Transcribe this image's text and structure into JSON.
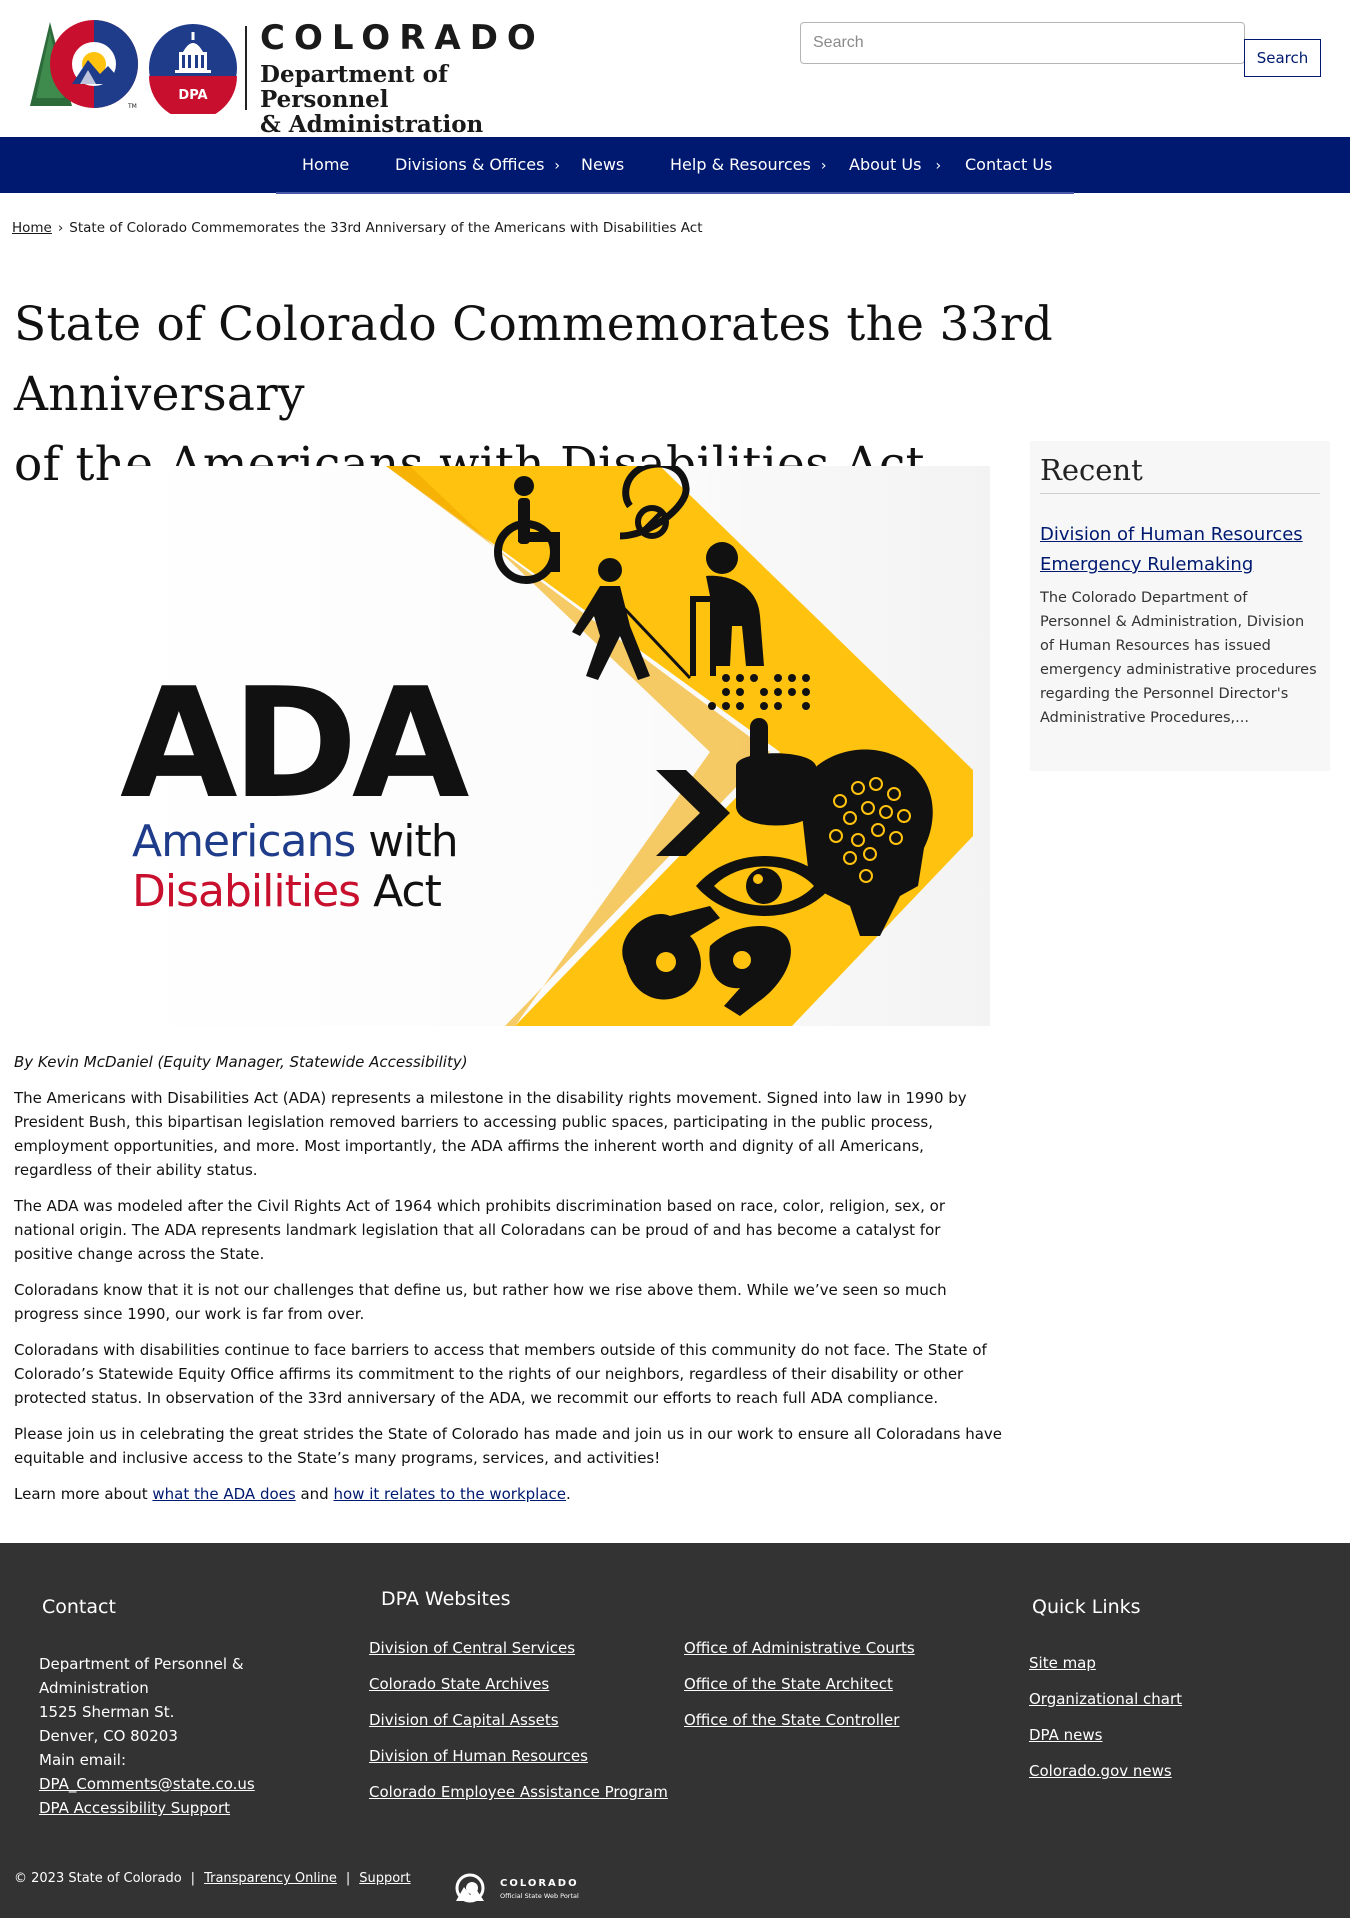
{
  "header": {
    "logo_state": "COLORADO",
    "logo_dept_line1": "Department of Personnel",
    "logo_dept_line2": "& Administration",
    "logo_badge": "DPA",
    "search_placeholder": "Search",
    "search_button": "Search"
  },
  "nav": {
    "items": [
      {
        "label": "Home",
        "has_submenu": false
      },
      {
        "label": "Divisions & Offices",
        "has_submenu": true
      },
      {
        "label": "News",
        "has_submenu": false
      },
      {
        "label": "Help & Resources",
        "has_submenu": true
      },
      {
        "label": "About Us",
        "has_submenu": true
      },
      {
        "label": "Contact Us",
        "has_submenu": false
      }
    ],
    "chevron": "›"
  },
  "breadcrumb": {
    "home": "Home",
    "separator": "›",
    "current": "State of Colorado Commemorates the 33rd Anniversary of the Americans with Disabilities Act"
  },
  "page_title_line1": "State of Colorado Commemorates the 33rd Anniversary",
  "page_title_line2": "of the Americans with Disabilities Act",
  "hero": {
    "ada": "ADA",
    "line1_a": "Americans",
    "line1_b": " with",
    "line2_a": "Disabilities",
    "line2_b": " Act"
  },
  "article": {
    "byline": "By Kevin McDaniel (Equity Manager, Statewide Accessibility)",
    "p1": "The Americans with Disabilities Act (ADA) represents a milestone in the disability rights movement. Signed into law in 1990 by President Bush, this bipartisan legislation removed barriers to accessing public spaces, participating in the public process, employment opportunities, and more. Most importantly, the ADA affirms the inherent worth and dignity of all Americans, regardless of their ability status.",
    "p2": "The ADA was modeled after the Civil Rights Act of 1964 which prohibits discrimination based on race, color, religion, sex, or national origin. The ADA represents landmark legislation that all Coloradans can be proud of and has become a catalyst for positive change across the State.",
    "p3": "Coloradans know that it is not our challenges that define us, but rather how we rise above them. While we’ve seen so much progress since 1990, our work is far from over.",
    "p4": "Coloradans with disabilities continue to face barriers to access that members outside of this community do not face. The State of Colorado’s Statewide Equity Office affirms its commitment to the rights of our neighbors, regardless of their disability or other protected status. In observation of the 33rd anniversary of the ADA, we recommit our efforts to reach full ADA compliance.",
    "p5": "Please join us in celebrating the great strides the State of Colorado has made and join us in our work to ensure all Coloradans have equitable and inclusive access to the State’s many programs, services, and activities!",
    "p6_pre": "Learn more about ",
    "p6_link1": "what the ADA does",
    "p6_mid": " and ",
    "p6_link2": "how it relates to the workplace",
    "p6_post": "."
  },
  "sidebar": {
    "title": "Recent",
    "link": "Division of Human Resources Emergency Rulemaking",
    "desc": "The Colorado Department of Personnel & Administration, Division of Human Resources has issued emergency administrative procedures regarding the Personnel Director's Administrative Procedures,..."
  },
  "footer": {
    "contact_title": "Contact",
    "contact_line1": "Department of Personnel &",
    "contact_line2": "Administration",
    "contact_line3": "1525 Sherman St.",
    "contact_line4": "Denver, CO 80203",
    "contact_line5": "Main email:",
    "contact_email": "DPA_Comments@state.co.us",
    "contact_access": "DPA Accessibility Support",
    "websites_title": "DPA Websites",
    "websites_col1": [
      "Division of Central Services",
      "Colorado State Archives",
      "Division of Capital Assets",
      "Division of Human Resources",
      "Colorado Employee Assistance Program"
    ],
    "websites_col2": [
      "Office of Administrative Courts",
      "Office of the State Architect",
      "Office of the State Controller"
    ],
    "quick_title": "Quick Links",
    "quick_links": [
      "Site map",
      "Organizational chart",
      "DPA news",
      "Colorado.gov news"
    ],
    "copyright": "© 2023 State of Colorado",
    "sep": "|",
    "transparency": "Transparency Online",
    "support": "Support",
    "portal_name": "COLORADO",
    "portal_sub": "Official State Web Portal"
  },
  "colors": {
    "nav_bg": "#001970",
    "footer_bg": "#333333",
    "ada_yellow": "#FFC20E",
    "ada_blue": "#1F3C8A",
    "ada_red": "#C8102E"
  }
}
